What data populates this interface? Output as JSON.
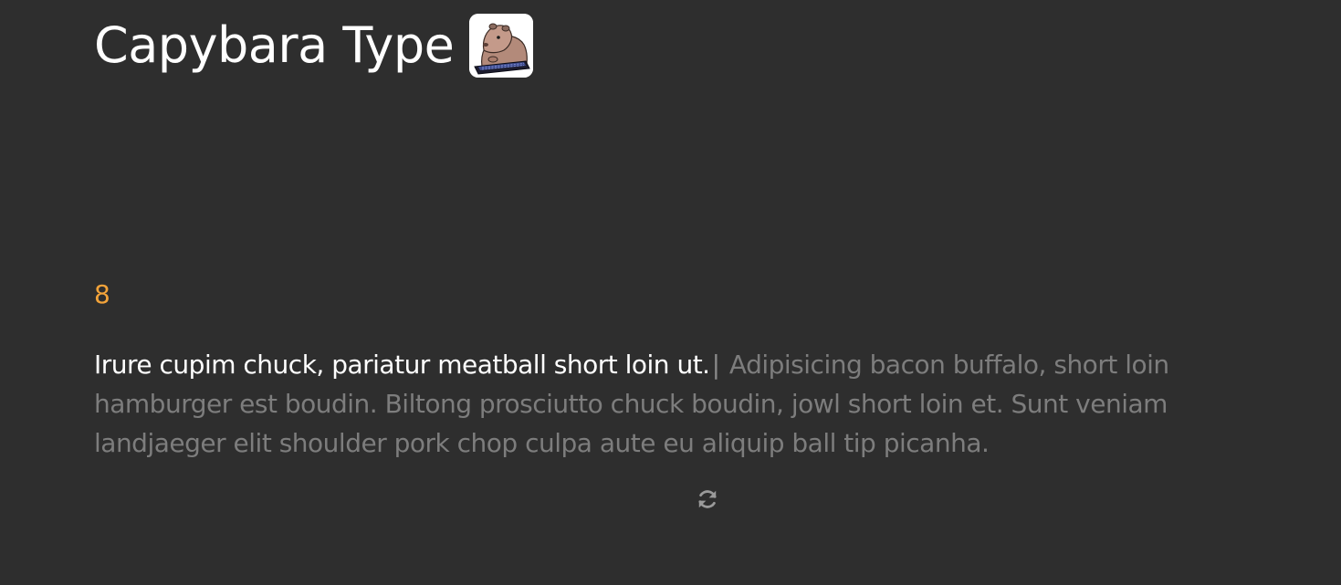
{
  "header": {
    "title": "Capybara Type",
    "logo_icon": "capybara-typing-icon"
  },
  "test": {
    "counter": "8",
    "typed_text": "Irure cupim chuck, pariatur meatball short loin ut.",
    "caret": "|",
    "remaining_text": " Adipisicing bacon buffalo, short loin hamburger est boudin. Biltong prosciutto chuck boudin, jowl short loin et. Sunt veniam landjaeger elit shoulder pork chop culpa aute eu aliquip ball tip picanha."
  },
  "controls": {
    "restart_icon": "refresh-icon"
  },
  "colors": {
    "background": "#2e2e2e",
    "typed": "#ffffff",
    "untyped": "#7d7d7d",
    "accent": "#f2a33a"
  }
}
